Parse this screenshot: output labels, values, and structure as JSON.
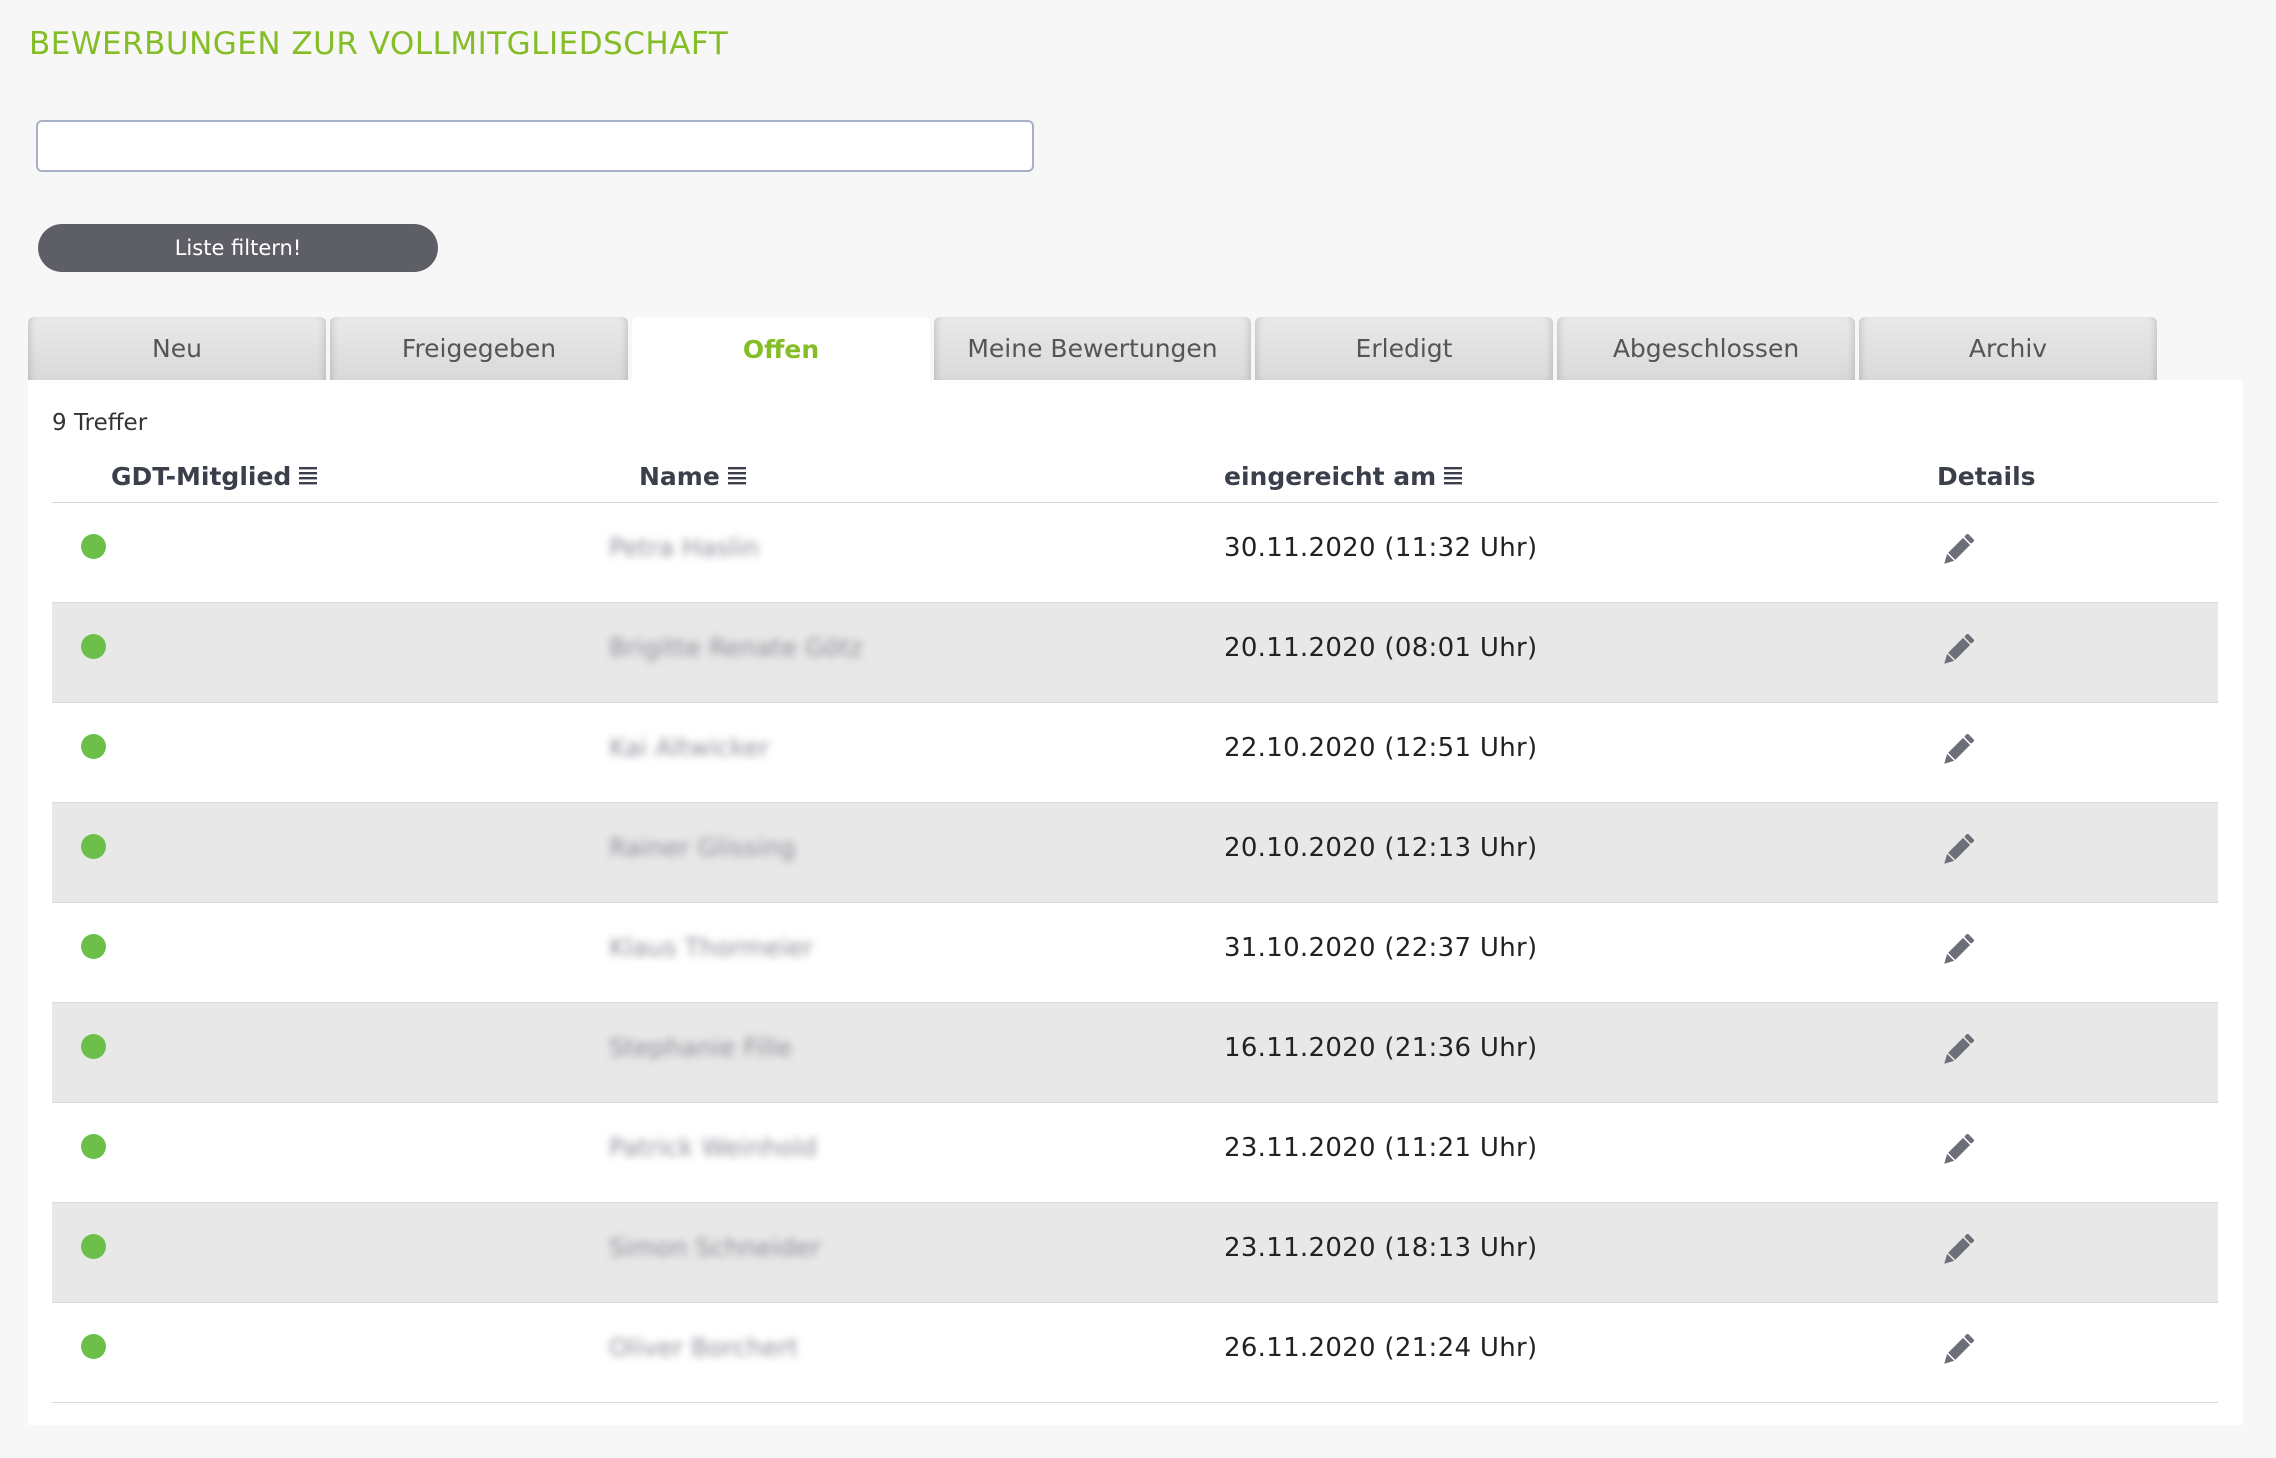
{
  "page": {
    "title": "BEWERBUNGEN ZUR VOLLMITGLIEDSCHAFT"
  },
  "search": {
    "value": "",
    "placeholder": ""
  },
  "filter_button": {
    "label": "Liste filtern!"
  },
  "tabs": [
    {
      "label": "Neu",
      "active": false
    },
    {
      "label": "Freigegeben",
      "active": false
    },
    {
      "label": "Offen",
      "active": true
    },
    {
      "label": "Meine Bewertungen",
      "active": false
    },
    {
      "label": "Erledigt",
      "active": false
    },
    {
      "label": "Abgeschlossen",
      "active": false
    },
    {
      "label": "Archiv",
      "active": false
    }
  ],
  "results": {
    "count_label": "9 Treffer"
  },
  "table": {
    "headers": {
      "member": "GDT-Mitglied",
      "name": "Name",
      "submitted": "eingereicht am",
      "details": "Details"
    },
    "rows": [
      {
        "member_status": "green-dot-icon",
        "name": "Petra Haslin",
        "submitted": "30.11.2020 (11:32 Uhr)"
      },
      {
        "member_status": "green-dot-icon",
        "name": "Brigitte Renate Götz",
        "submitted": "20.11.2020 (08:01 Uhr)"
      },
      {
        "member_status": "green-dot-icon",
        "name": "Kai Altwicker",
        "submitted": "22.10.2020 (12:51 Uhr)"
      },
      {
        "member_status": "green-dot-icon",
        "name": "Rainer Glissing",
        "submitted": "20.10.2020 (12:13 Uhr)"
      },
      {
        "member_status": "green-dot-icon",
        "name": "Klaus Thormeier",
        "submitted": "31.10.2020 (22:37 Uhr)"
      },
      {
        "member_status": "green-dot-icon",
        "name": "Stephanie Fille",
        "submitted": "16.11.2020 (21:36 Uhr)"
      },
      {
        "member_status": "green-dot-icon",
        "name": "Patrick Weinhold",
        "submitted": "23.11.2020 (11:21 Uhr)"
      },
      {
        "member_status": "green-dot-icon",
        "name": "Simon Schneider",
        "submitted": "23.11.2020 (18:13 Uhr)"
      },
      {
        "member_status": "green-dot-icon",
        "name": "Oliver Borchert",
        "submitted": "26.11.2020 (21:24 Uhr)"
      }
    ]
  },
  "colors": {
    "accent": "#85bd26",
    "status_green": "#6cc04a",
    "button_bg": "#5e5f66",
    "row_alt": "#e8e8e8"
  },
  "icons": {
    "sort": "sort-list-icon",
    "edit": "pencil-icon"
  }
}
